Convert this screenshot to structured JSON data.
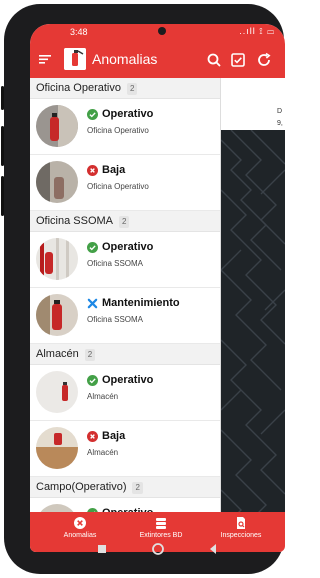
{
  "statusbar": {
    "time": "3:48",
    "icons": "..ıll ⟟ ▭"
  },
  "appbar": {
    "title": "Anomalias"
  },
  "groups": [
    {
      "name": "Oficina Operativo",
      "count": "2",
      "items": [
        {
          "status": "Operativo",
          "location": "Oficina Operativo"
        },
        {
          "status": "Baja",
          "location": "Oficina Operativo"
        }
      ]
    },
    {
      "name": "Oficina SSOMA",
      "count": "2",
      "items": [
        {
          "status": "Operativo",
          "location": "Oficina SSOMA"
        },
        {
          "status": "Mantenimiento",
          "location": "Oficina SSOMA"
        }
      ]
    },
    {
      "name": "Almacén",
      "count": "2",
      "items": [
        {
          "status": "Operativo",
          "location": "Almacén"
        },
        {
          "status": "Baja",
          "location": "Almacén"
        }
      ]
    },
    {
      "name": "Campo(Operativo)",
      "count": "2",
      "items": [
        {
          "status": "Operativo",
          "location": ""
        }
      ]
    }
  ],
  "right_pane": {
    "line1": "D",
    "line2": "9,"
  },
  "bottom_nav": [
    {
      "label": "Anomalias",
      "icon": "close-circle-icon"
    },
    {
      "label": "Extintores BD",
      "icon": "database-icon"
    },
    {
      "label": "Inspecciones",
      "icon": "document-search-icon"
    }
  ],
  "colors": {
    "primary": "#e53935",
    "ok": "#43a047",
    "bad": "#d32f2f",
    "maint": "#1e88e5"
  }
}
